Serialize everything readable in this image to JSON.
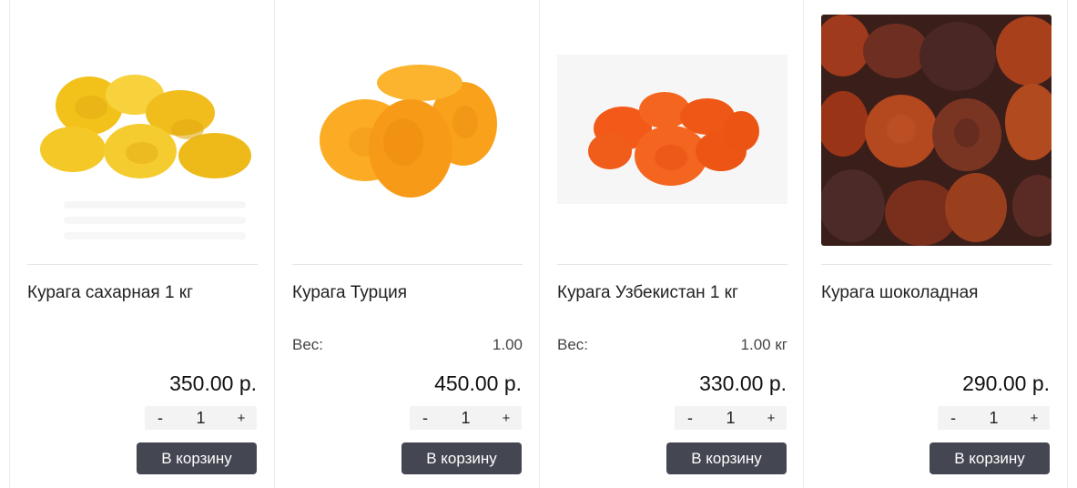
{
  "products": [
    {
      "title": "Курага сахарная 1 кг",
      "weight_label": "",
      "weight_value": "",
      "price": "350.00 р.",
      "qty": "1",
      "minus": "-",
      "plus": "+",
      "cart_label": "В корзину",
      "image_icon": "dried-apricot-yellow-icon"
    },
    {
      "title": "Курага Турция",
      "weight_label": "Вес:",
      "weight_value": "1.00",
      "price": "450.00 р.",
      "qty": "1",
      "minus": "-",
      "plus": "+",
      "cart_label": "В корзину",
      "image_icon": "dried-apricot-orange-icon"
    },
    {
      "title": "Курага Узбекистан 1 кг",
      "weight_label": "Вес:",
      "weight_value": "1.00 кг",
      "price": "330.00 р.",
      "qty": "1",
      "minus": "-",
      "plus": "+",
      "cart_label": "В корзину",
      "image_icon": "dried-apricot-red-icon"
    },
    {
      "title": "Курага шоколадная",
      "weight_label": "",
      "weight_value": "",
      "price": "290.00 р.",
      "qty": "1",
      "minus": "-",
      "plus": "+",
      "cart_label": "В корзину",
      "image_icon": "dried-apricot-chocolate-icon"
    }
  ],
  "colors": {
    "button_bg": "#444652",
    "button_text": "#ffffff",
    "qty_bg": "#f3f3f3",
    "border": "#ececec"
  }
}
